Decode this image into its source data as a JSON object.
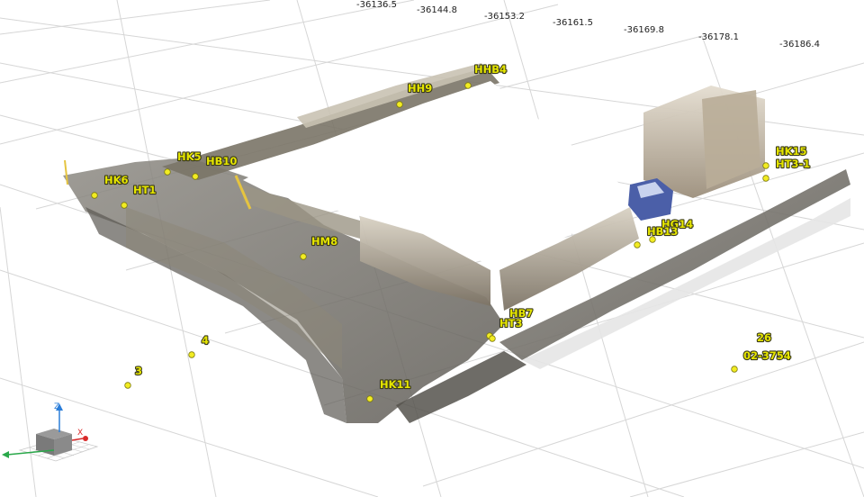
{
  "scale_labels": [
    "-36136.5",
    "-36144.8",
    "-36153.2",
    "-36161.5",
    "-36169.8",
    "-36178.1",
    "-36186.4"
  ],
  "points": [
    {
      "name": "HHB4",
      "label": "HHB4"
    },
    {
      "name": "HH9",
      "label": "HH9"
    },
    {
      "name": "HK5",
      "label": "HK5"
    },
    {
      "name": "HB10",
      "label": "HB10"
    },
    {
      "name": "HK6",
      "label": "HK6"
    },
    {
      "name": "HT1",
      "label": "HT1"
    },
    {
      "name": "HM8",
      "label": "HM8"
    },
    {
      "name": "HK15",
      "label": "HK15"
    },
    {
      "name": "HT3-1",
      "label": "HT3-1"
    },
    {
      "name": "HG14",
      "label": "HG14"
    },
    {
      "name": "HB13",
      "label": "HB13"
    },
    {
      "name": "HB7",
      "label": "HB7"
    },
    {
      "name": "HT3",
      "label": "HT3"
    },
    {
      "name": "HK11",
      "label": "HK11"
    },
    {
      "name": "4",
      "label": "4"
    },
    {
      "name": "3",
      "label": "3"
    },
    {
      "name": "26",
      "label": "26"
    },
    {
      "name": "02-3754",
      "label": "02-3754"
    }
  ],
  "orientation_gizmo": {
    "z": "Z",
    "x": "X",
    "y": "Y"
  },
  "colors": {
    "marker": "#f2ec22",
    "label": "#e6e600",
    "grid": "#d6d6d6",
    "background": "#ffffff"
  }
}
